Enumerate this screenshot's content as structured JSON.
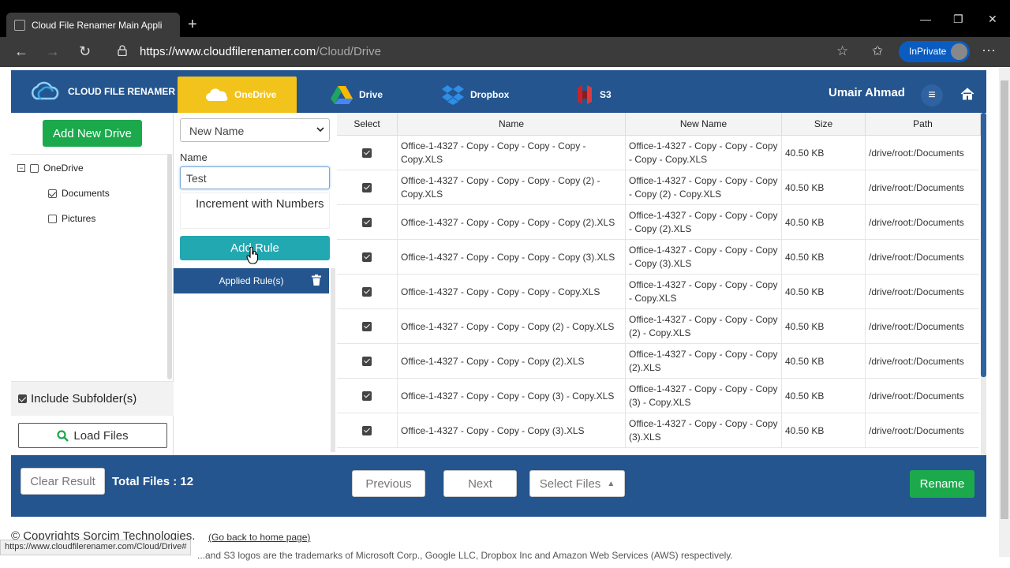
{
  "browser": {
    "tab_title": "Cloud File Renamer Main Application",
    "url_host": "https://www.cloudfilerenamer.com",
    "url_path": "/Cloud/Drive",
    "inprivate_label": "InPrivate",
    "status_url": "https://www.cloudfilerenamer.com/Cloud/Drive#"
  },
  "header": {
    "logo_text": "CLOUD FILE RENAMER",
    "tabs": [
      {
        "label": "OneDrive",
        "active": true
      },
      {
        "label": "Drive"
      },
      {
        "label": "Dropbox"
      },
      {
        "label": "S3"
      }
    ],
    "user_name": "Umair Ahmad"
  },
  "left_panel": {
    "add_drive_label": "Add New Drive",
    "tree": [
      {
        "label": "OneDrive",
        "expander": "−",
        "checked": false
      },
      {
        "label": "Documents",
        "checked": true
      },
      {
        "label": "Pictures",
        "checked": false
      }
    ],
    "include_subfolders_label": "Include Subfolder(s)",
    "load_files_label": "Load Files"
  },
  "rules_panel": {
    "rule_type": "New Name",
    "name_label": "Name",
    "name_value": "Test",
    "increment_label": "Increment with Numbers",
    "add_rule_label": "Add Rule",
    "applied_rules_label": "Applied Rule(s)"
  },
  "table": {
    "headers": [
      "Select",
      "Name",
      "New Name",
      "Size",
      "Path"
    ],
    "rows": [
      {
        "name": "Office-1-4327 - Copy - Copy - Copy - Copy - Copy.XLS",
        "new_name": "Office-1-4327 - Copy - Copy - Copy - Copy - Copy.XLS",
        "size": "40.50 KB",
        "path": "/drive/root:/Documents"
      },
      {
        "name": "Office-1-4327 - Copy - Copy - Copy - Copy (2) - Copy.XLS",
        "new_name": "Office-1-4327 - Copy - Copy - Copy - Copy (2) - Copy.XLS",
        "size": "40.50 KB",
        "path": "/drive/root:/Documents"
      },
      {
        "name": "Office-1-4327 - Copy - Copy - Copy - Copy (2).XLS",
        "new_name": "Office-1-4327 - Copy - Copy - Copy - Copy (2).XLS",
        "size": "40.50 KB",
        "path": "/drive/root:/Documents"
      },
      {
        "name": "Office-1-4327 - Copy - Copy - Copy - Copy (3).XLS",
        "new_name": "Office-1-4327 - Copy - Copy - Copy - Copy (3).XLS",
        "size": "40.50 KB",
        "path": "/drive/root:/Documents"
      },
      {
        "name": "Office-1-4327 - Copy - Copy - Copy - Copy.XLS",
        "new_name": "Office-1-4327 - Copy - Copy - Copy - Copy.XLS",
        "size": "40.50 KB",
        "path": "/drive/root:/Documents"
      },
      {
        "name": "Office-1-4327 - Copy - Copy - Copy (2) - Copy.XLS",
        "new_name": "Office-1-4327 - Copy - Copy - Copy (2) - Copy.XLS",
        "size": "40.50 KB",
        "path": "/drive/root:/Documents"
      },
      {
        "name": "Office-1-4327 - Copy - Copy - Copy (2).XLS",
        "new_name": "Office-1-4327 - Copy - Copy - Copy (2).XLS",
        "size": "40.50 KB",
        "path": "/drive/root:/Documents"
      },
      {
        "name": "Office-1-4327 - Copy - Copy - Copy (3) - Copy.XLS",
        "new_name": "Office-1-4327 - Copy - Copy - Copy (3) - Copy.XLS",
        "size": "40.50 KB",
        "path": "/drive/root:/Documents"
      },
      {
        "name": "Office-1-4327 - Copy - Copy - Copy (3).XLS",
        "new_name": "Office-1-4327 - Copy - Copy - Copy (3).XLS",
        "size": "40.50 KB",
        "path": "/drive/root:/Documents"
      }
    ]
  },
  "footer": {
    "clear_label": "Clear Result",
    "total_files": "Total Files : 12",
    "previous_label": "Previous",
    "next_label": "Next",
    "select_files_label": "Select Files",
    "rename_label": "Rename"
  },
  "page_footer": {
    "copyright": "© Copyrights Sorcim Technologies.",
    "home_link": "(Go back to home page)",
    "trademark": "...and S3 logos are the trademarks of Microsoft Corp., Google LLC, Dropbox Inc and Amazon Web Services (AWS) respectively."
  },
  "colors": {
    "brand_blue": "#24558f",
    "active_tab": "#f2c31b",
    "green": "#1ba94c",
    "teal": "#21a8b0"
  }
}
